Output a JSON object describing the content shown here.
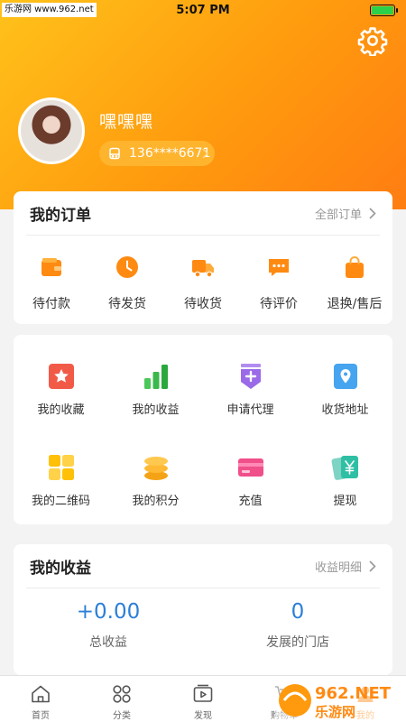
{
  "statusbar": {
    "watermark": "乐游网 www.962.net",
    "time": "5:07 PM"
  },
  "profile": {
    "username": "嘿嘿嘿",
    "phone": "136****6671"
  },
  "orders": {
    "title": "我的订单",
    "all_label": "全部订单",
    "items": [
      {
        "label": "待付款",
        "icon": "wallet-icon"
      },
      {
        "label": "待发货",
        "icon": "clock-icon"
      },
      {
        "label": "待收货",
        "icon": "truck-icon"
      },
      {
        "label": "待评价",
        "icon": "chat-icon"
      },
      {
        "label": "退换/售后",
        "icon": "bag-icon"
      }
    ]
  },
  "services": {
    "items": [
      {
        "label": "我的收藏",
        "icon": "star-icon"
      },
      {
        "label": "我的收益",
        "icon": "bar-chart-icon"
      },
      {
        "label": "申请代理",
        "icon": "badge-plus-icon"
      },
      {
        "label": "收货地址",
        "icon": "location-icon"
      },
      {
        "label": "我的二维码",
        "icon": "qrcode-icon"
      },
      {
        "label": "我的积分",
        "icon": "coins-icon"
      },
      {
        "label": "充值",
        "icon": "card-icon"
      },
      {
        "label": "提现",
        "icon": "yen-icon"
      }
    ]
  },
  "income": {
    "title": "我的收益",
    "detail_label": "收益明细",
    "total_value": "+0.00",
    "total_label": "总收益",
    "stores_value": "0",
    "stores_label": "发展的门店"
  },
  "tabs": [
    {
      "label": "首页",
      "icon": "home-icon"
    },
    {
      "label": "分类",
      "icon": "grid-icon"
    },
    {
      "label": "发现",
      "icon": "play-icon"
    },
    {
      "label": "购物车",
      "icon": "cart-icon"
    },
    {
      "label": "我的",
      "icon": "user-icon"
    }
  ],
  "overlay_watermark": "962.NET 乐游网",
  "colors": {
    "accent": "#ff8a12",
    "value_blue": "#2b7fd8",
    "header_start": "#ffc21a",
    "header_end": "#ff7d12"
  }
}
